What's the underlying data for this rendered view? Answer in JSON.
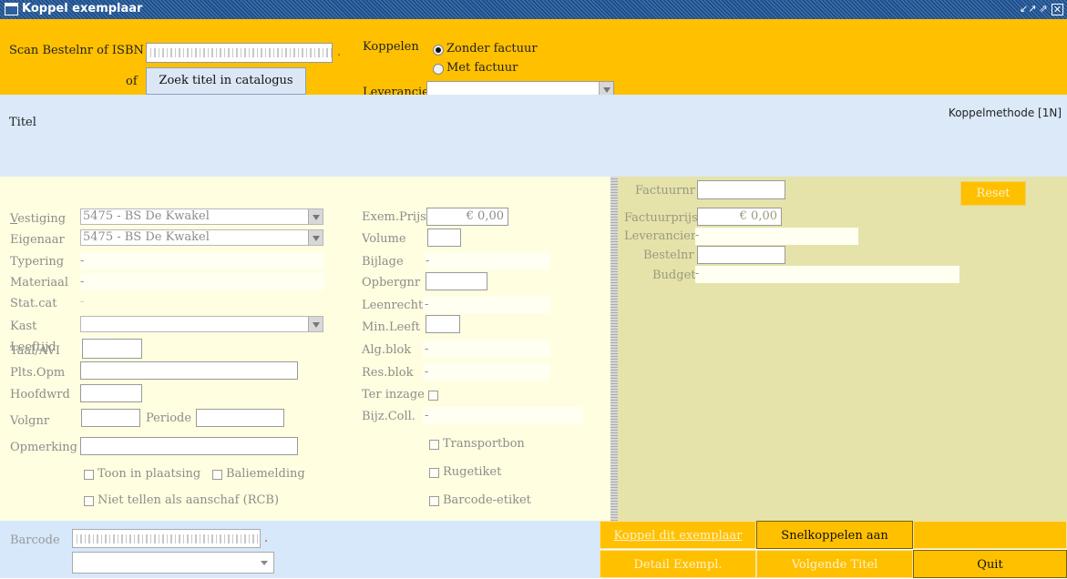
{
  "window": {
    "title": "Koppel exemplaar",
    "controls": [
      "restore-icon",
      "maximize-icon",
      "close-icon"
    ]
  },
  "scan": {
    "label": "Scan Bestelnr of ISBN",
    "value": "",
    "dot": "."
  },
  "zoek": {
    "of_label": "of",
    "button_label": "Zoek titel in catalogus"
  },
  "koppelen": {
    "label": "Koppelen",
    "options": [
      "Zonder factuur",
      "Met factuur"
    ],
    "selected": "Zonder factuur",
    "leverancier_label": "Leverancier",
    "leverancier_value": ""
  },
  "titel": {
    "label": "Titel",
    "koppelmethode": "Koppelmethode [1N]"
  },
  "left_form": {
    "vestiging": {
      "label": "Vestiging",
      "value": "5475 - BS De Kwakel"
    },
    "eigenaar": {
      "label": "Eigenaar",
      "value": "5475 - BS De Kwakel"
    },
    "typering": {
      "label": "Typering",
      "value": "-"
    },
    "materiaal": {
      "label": "Materiaal",
      "value": "-"
    },
    "statcat": {
      "label": "Stat.cat",
      "value": "-"
    },
    "kast": {
      "label": "Kast",
      "value": ""
    },
    "leeftijd": {
      "label": "Leeftijd",
      "value": ""
    },
    "taal": {
      "label": "Taal/AVI",
      "value": ""
    },
    "plts": {
      "label": "Plts.Opm",
      "value": ""
    },
    "hoofdwrd": {
      "label": "Hoofdwrd",
      "value": ""
    },
    "volgnr": {
      "label": "Volgnr",
      "value": ""
    },
    "periode": {
      "label": "Periode",
      "value": ""
    },
    "opmerking": {
      "label": "Opmerking",
      "value": ""
    },
    "toon": "Toon in plaatsing",
    "baliemelding": "Baliemelding",
    "niet_tellen": "Niet tellen als aanschaf (RCB)"
  },
  "mid_form": {
    "exem_prijs": {
      "label": "Exem.Prijs",
      "value": "€ 0,00"
    },
    "volume": {
      "label": "Volume",
      "value": ""
    },
    "bijlage": {
      "label": "Bijlage",
      "value": "-"
    },
    "opbergnr": {
      "label": "Opbergnr",
      "value": ""
    },
    "leenrecht": {
      "label": "Leenrecht",
      "value": "-"
    },
    "min_leeft": {
      "label": "Min.Leeft",
      "value": ""
    },
    "alg_blok": {
      "label": "Alg.blok",
      "value": "-"
    },
    "res_blok": {
      "label": "Res.blok",
      "value": "-"
    },
    "ter_inzage": {
      "label": "Ter inzage"
    },
    "bijz_coll": {
      "label": "Bijz.Coll.",
      "value": "-"
    },
    "transportbon": "Transportbon",
    "rugetiket": "Rugetiket",
    "barcode_etiket": "Barcode-etiket"
  },
  "right_form": {
    "factuurnr": {
      "label": "Factuurnr",
      "value": ""
    },
    "factuurprijs": {
      "label": "Factuurprijs",
      "value": "€ 0,00"
    },
    "leverancier": {
      "label": "Leverancier",
      "value": "-"
    },
    "bestelnr": {
      "label": "Bestelnr",
      "value": ""
    },
    "budget": {
      "label": "Budget",
      "value": "-"
    },
    "reset_label": "Reset"
  },
  "bottom": {
    "barcode_label": "Barcode",
    "barcode_value": "",
    "barcode_dot": ".",
    "koppel_btn": "Koppel dit exemplaar",
    "snel_btn": "Snelkoppelen aan",
    "detail_btn": "Detail Exempl.",
    "volgende_btn": "Volgende Titel",
    "quit_btn": "Quit"
  },
  "colors": {
    "accent_yellow": "#ffc000",
    "title_blue": "#1b4f8f",
    "panel_cream": "#fffee0",
    "panel_olive": "#e5e3a9",
    "band_blue": "#dbe9f9"
  }
}
